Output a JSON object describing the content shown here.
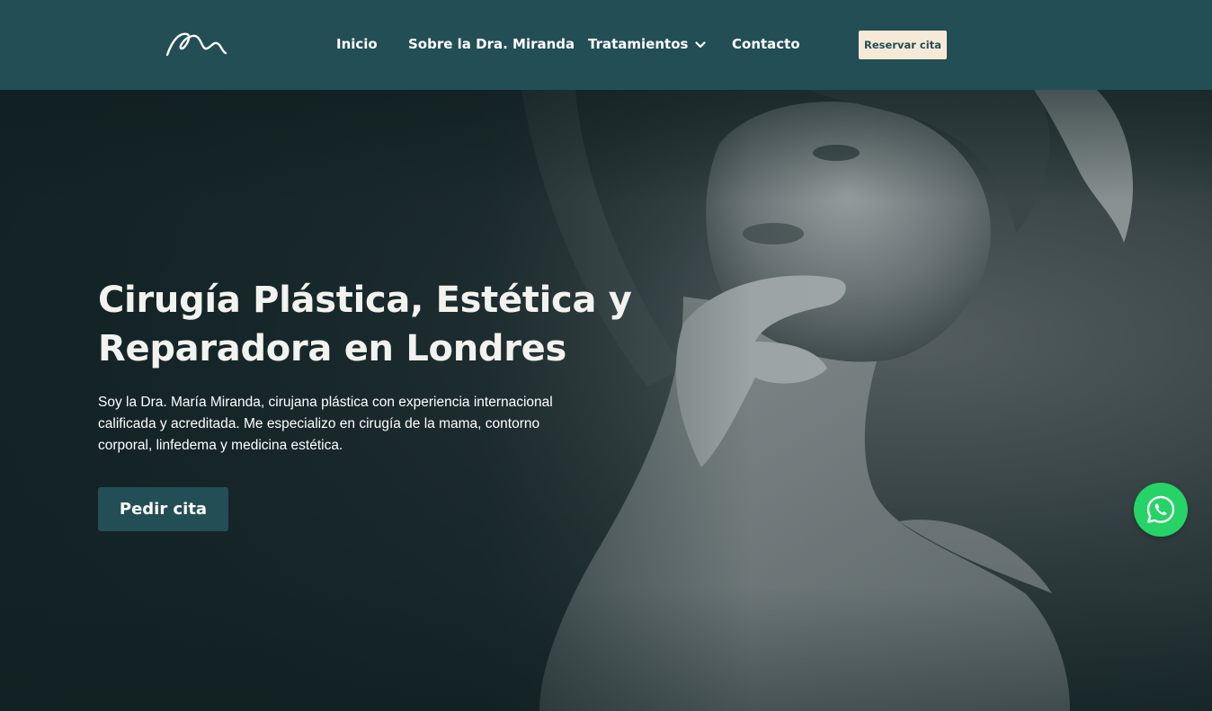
{
  "header": {
    "logo": "MM signature logo",
    "nav": [
      {
        "label": "Inicio"
      },
      {
        "label": "Sobre la Dra. Miranda"
      },
      {
        "label": "Tratamientos"
      },
      {
        "label": "Contacto"
      }
    ],
    "book_button": "Reservar cita"
  },
  "hero": {
    "title": "Cirugía Plástica, Estética y Reparadora en Londres",
    "description": "Soy la Dra. María Miranda, cirujana plástica con experiencia internacional calificada y acreditada. Me especializo en cirugía de la mama, contorno corporal, linfedema y medicina estética.",
    "cta": "Pedir cita"
  },
  "icons": {
    "logo": "signature-logo-icon",
    "dropdown": "chevron-down-icon",
    "whatsapp": "whatsapp-icon"
  },
  "colors": {
    "header_bg": "#234e55",
    "button_cream": "#f7e9d8",
    "cta_bg": "#234e55",
    "whatsapp": "#25d366"
  }
}
